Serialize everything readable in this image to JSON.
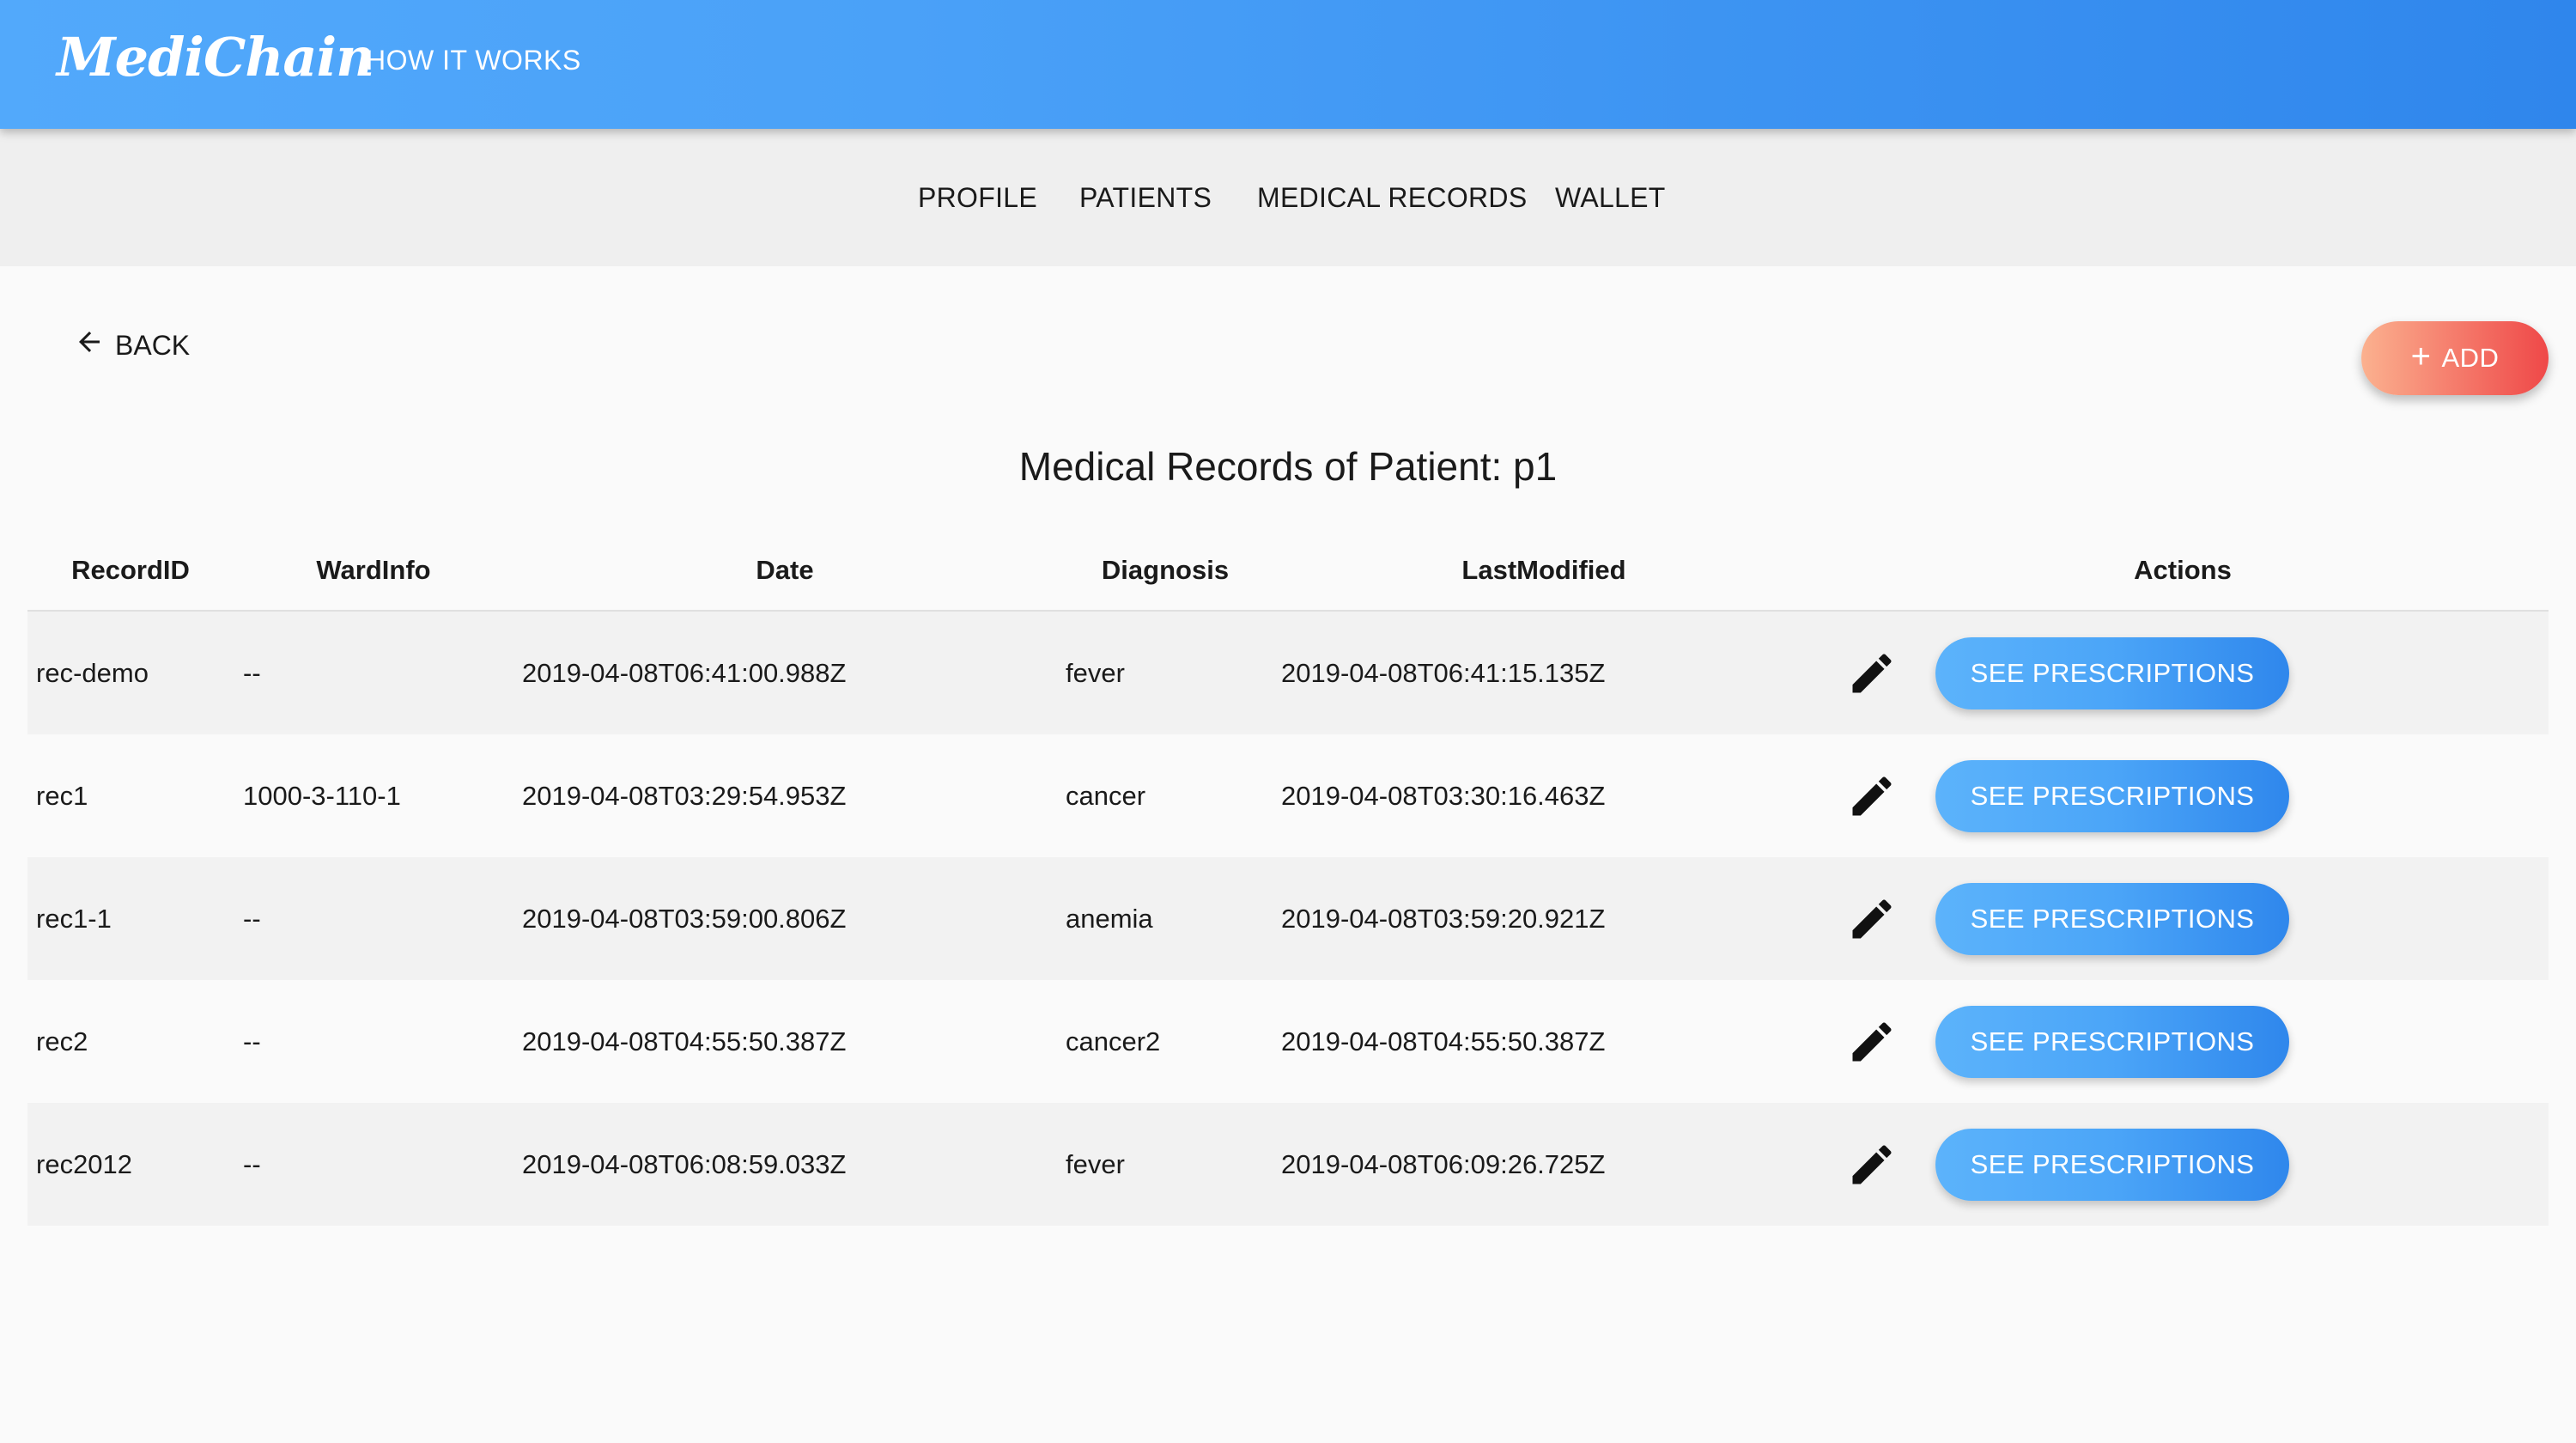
{
  "appbar": {
    "logo": "MediChain",
    "how_it_works": "HOW IT WORKS"
  },
  "subnav": {
    "items": [
      {
        "label": "PROFILE"
      },
      {
        "label": "PATIENTS"
      },
      {
        "label": "MEDICAL RECORDS"
      },
      {
        "label": "WALLET"
      }
    ]
  },
  "back_label": "BACK",
  "add_label": "ADD",
  "page_title": "Medical Records of Patient: p1",
  "table": {
    "columns": [
      "RecordID",
      "WardInfo",
      "Date",
      "Diagnosis",
      "LastModified",
      "Actions"
    ],
    "action_label": "SEE PRESCRIPTIONS",
    "rows": [
      {
        "record_id": "rec-demo",
        "ward": "--",
        "date": "2019-04-08T06:41:00.988Z",
        "diagnosis": "fever",
        "last_modified": "2019-04-08T06:41:15.135Z"
      },
      {
        "record_id": "rec1",
        "ward": "1000-3-110-1",
        "date": "2019-04-08T03:29:54.953Z",
        "diagnosis": "cancer",
        "last_modified": "2019-04-08T03:30:16.463Z"
      },
      {
        "record_id": "rec1-1",
        "ward": "--",
        "date": "2019-04-08T03:59:00.806Z",
        "diagnosis": "anemia",
        "last_modified": "2019-04-08T03:59:20.921Z"
      },
      {
        "record_id": "rec2",
        "ward": "--",
        "date": "2019-04-08T04:55:50.387Z",
        "diagnosis": "cancer2",
        "last_modified": "2019-04-08T04:55:50.387Z"
      },
      {
        "record_id": "rec2012",
        "ward": "--",
        "date": "2019-04-08T06:08:59.033Z",
        "diagnosis": "fever",
        "last_modified": "2019-04-08T06:09:26.725Z"
      }
    ]
  },
  "colors": {
    "appbar_start": "#52a9fb",
    "appbar_end": "#2f86ec",
    "add_start": "#fbb18f",
    "add_end": "#ef4848",
    "action_button": "#4ba5f8"
  },
  "icons": {
    "back": "arrow-left-icon",
    "add": "plus-icon",
    "edit": "pencil-icon"
  }
}
